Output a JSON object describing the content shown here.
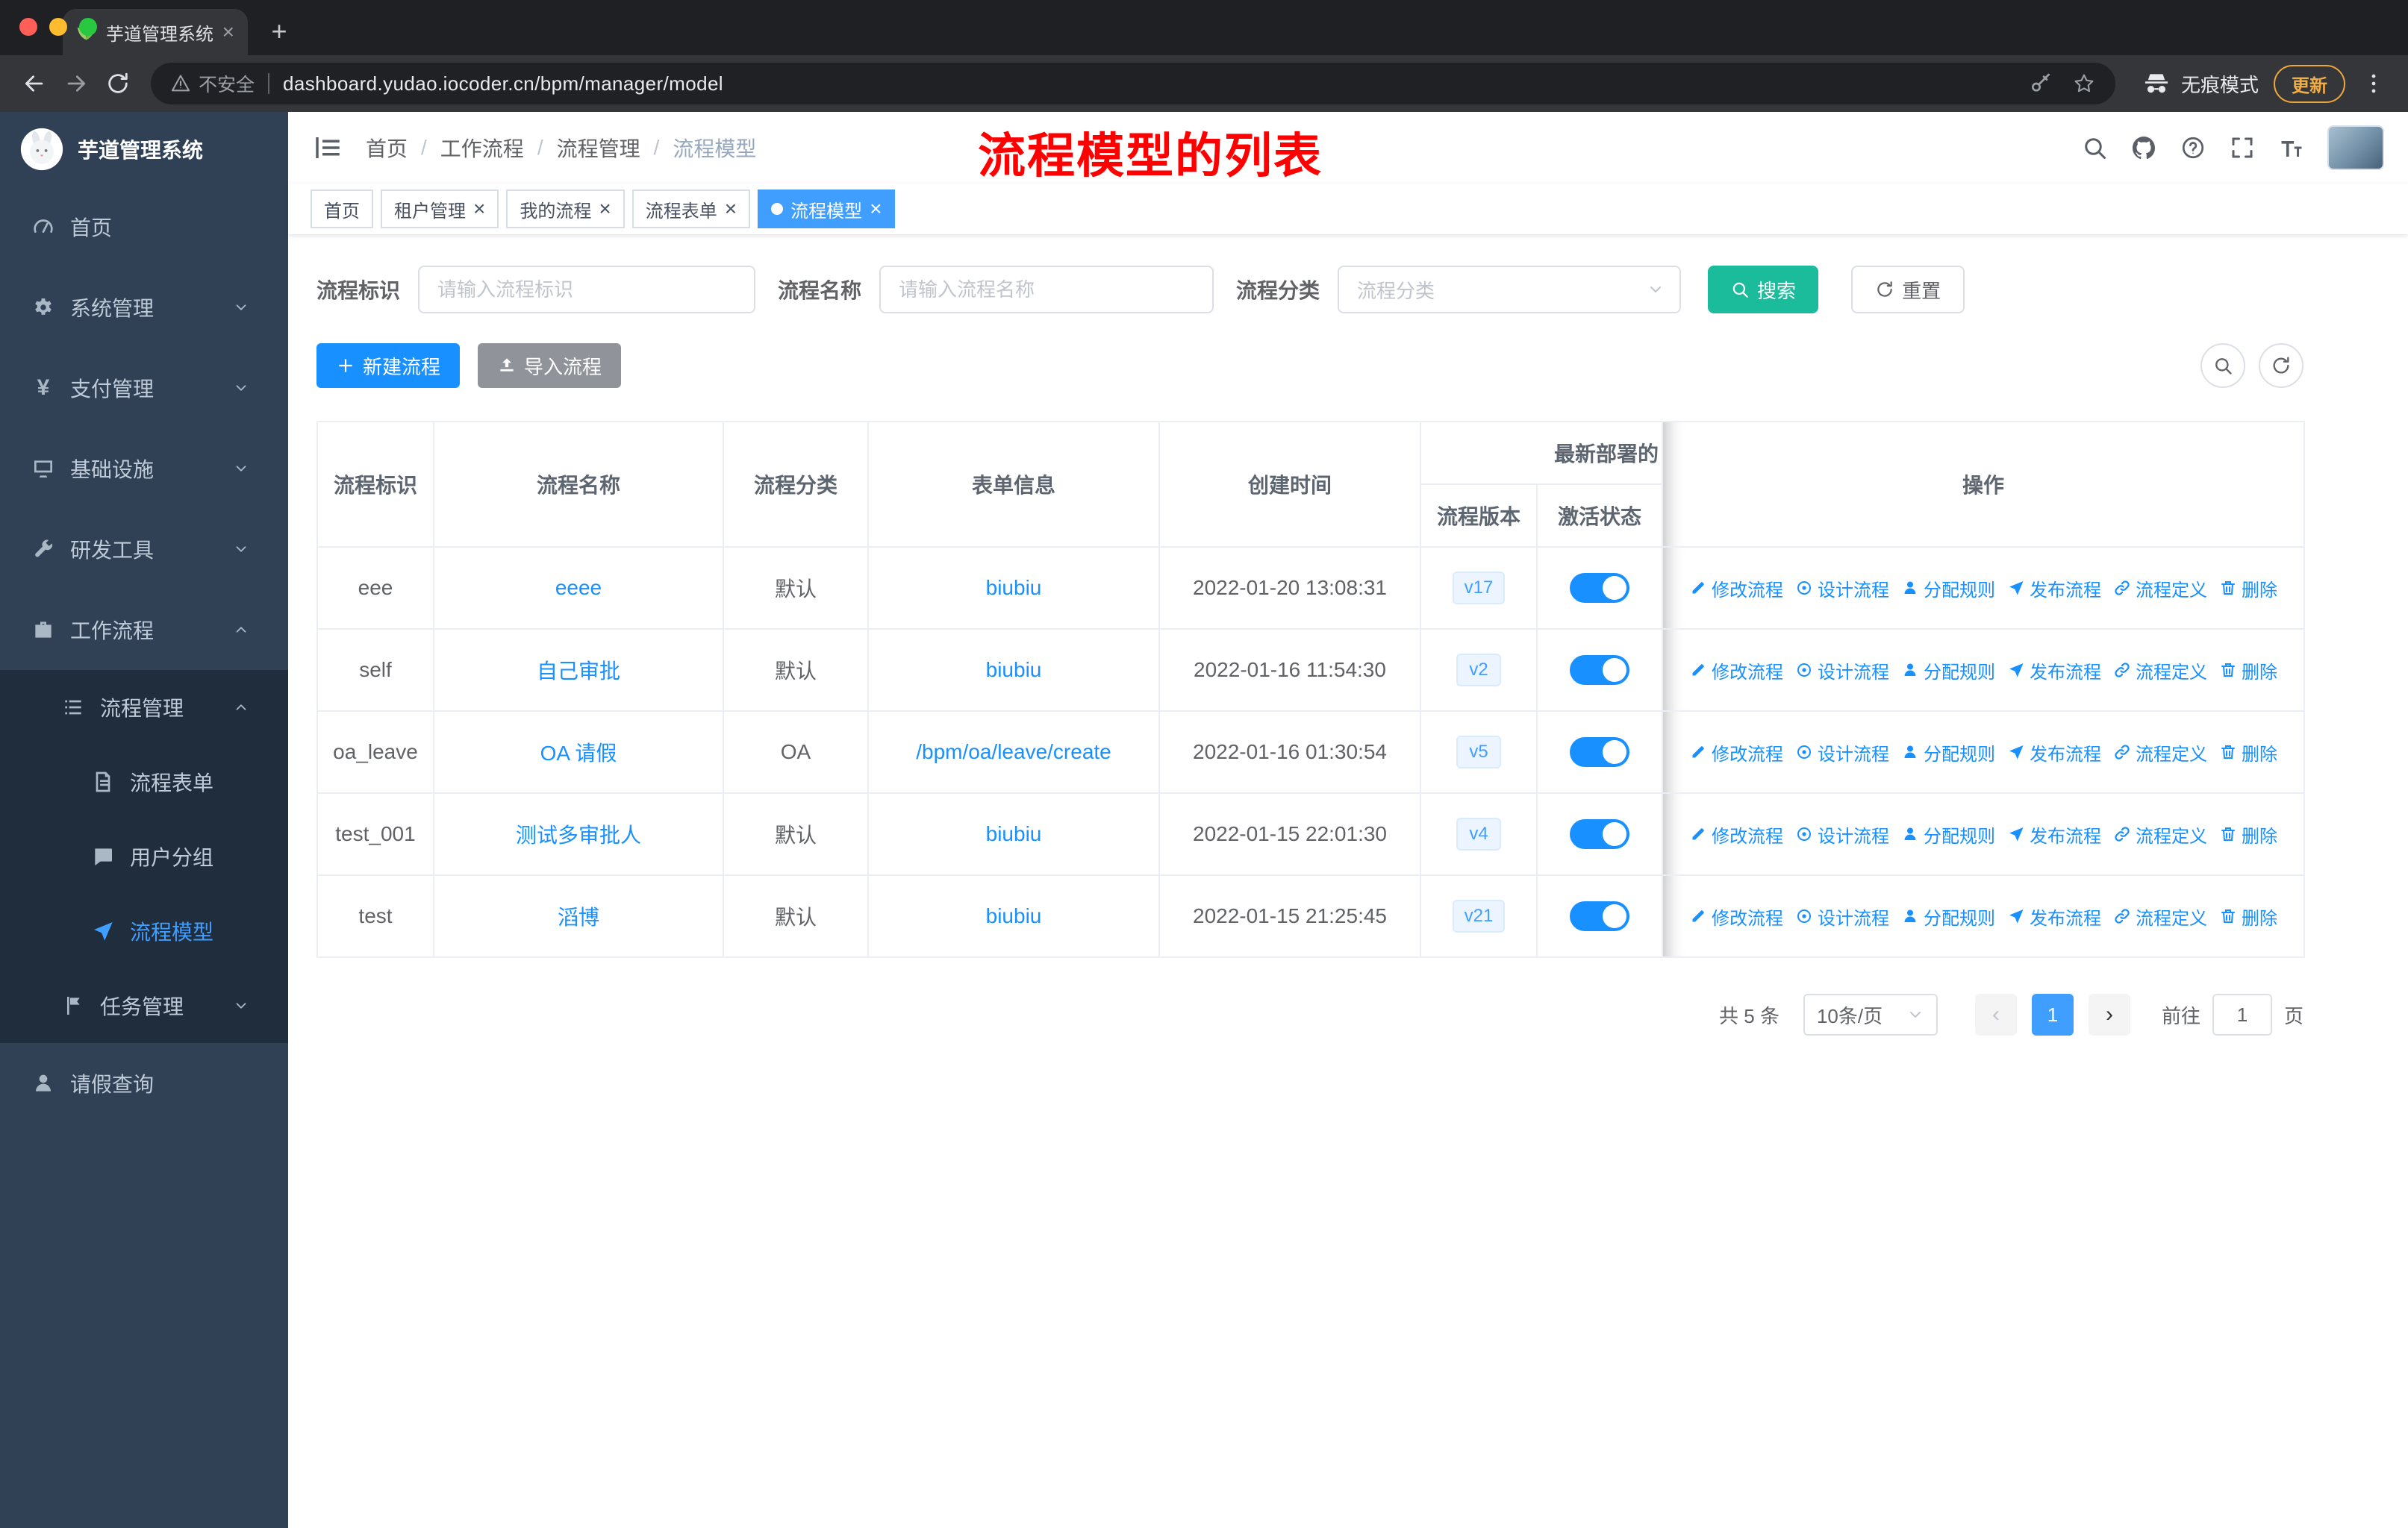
{
  "browser": {
    "tab_title": "芋道管理系统",
    "url": "dashboard.yudao.iocoder.cn/bpm/manager/model",
    "security_label": "不安全",
    "incognito_label": "无痕模式",
    "update_button": "更新"
  },
  "sidebar": {
    "logo_title": "芋道管理系统",
    "items": [
      {
        "key": "home",
        "label": "首页",
        "icon": "dashboard-icon",
        "level": 1
      },
      {
        "key": "system",
        "label": "系统管理",
        "icon": "gear-icon",
        "level": 1,
        "chevron": "down"
      },
      {
        "key": "payment",
        "label": "支付管理",
        "icon": "payment-icon",
        "level": 1,
        "chevron": "down"
      },
      {
        "key": "infrastructure",
        "label": "基础设施",
        "icon": "infrastructure-icon",
        "level": 1,
        "chevron": "down"
      },
      {
        "key": "devtools",
        "label": "研发工具",
        "icon": "tool-icon",
        "level": 1,
        "chevron": "down"
      },
      {
        "key": "workflow",
        "label": "工作流程",
        "icon": "workflow-icon",
        "level": 1,
        "chevron": "up"
      },
      {
        "key": "process-management",
        "label": "流程管理",
        "icon": "process-icon",
        "level": 2,
        "chevron": "up",
        "dark": true
      },
      {
        "key": "process-form",
        "label": "流程表单",
        "icon": "form-icon",
        "level": 3,
        "dark": true
      },
      {
        "key": "user-group",
        "label": "用户分组",
        "icon": "group-icon",
        "level": 3,
        "dark": true
      },
      {
        "key": "process-model",
        "label": "流程模型",
        "icon": "model-icon",
        "level": 3,
        "dark": true,
        "active": true
      },
      {
        "key": "task-management",
        "label": "任务管理",
        "icon": "task-icon",
        "level": 2,
        "chevron": "down",
        "dark": true
      },
      {
        "key": "leave-query",
        "label": "请假查询",
        "icon": "user-icon",
        "level": 1
      }
    ]
  },
  "header": {
    "breadcrumb": [
      "首页",
      "工作流程",
      "流程管理",
      "流程模型"
    ],
    "annotation": "流程模型的列表"
  },
  "tabs": [
    {
      "key": "home",
      "label": "首页",
      "closable": false,
      "active": false
    },
    {
      "key": "tenant",
      "label": "租户管理",
      "closable": true,
      "active": false
    },
    {
      "key": "my-process",
      "label": "我的流程",
      "closable": true,
      "active": false
    },
    {
      "key": "process-form",
      "label": "流程表单",
      "closable": true,
      "active": false
    },
    {
      "key": "process-model",
      "label": "流程模型",
      "closable": true,
      "active": true
    }
  ],
  "filters": {
    "fields": [
      {
        "label": "流程标识",
        "placeholder": "请输入流程标识",
        "type": "input"
      },
      {
        "label": "流程名称",
        "placeholder": "请输入流程名称",
        "type": "input"
      },
      {
        "label": "流程分类",
        "placeholder": "流程分类",
        "type": "select"
      }
    ],
    "search_label": "搜索",
    "reset_label": "重置"
  },
  "toolbar": {
    "create_label": "新建流程",
    "import_label": "导入流程"
  },
  "table": {
    "columns": [
      "流程标识",
      "流程名称",
      "流程分类",
      "表单信息",
      "创建时间"
    ],
    "group_header": "最新部署的",
    "sub_columns": [
      "流程版本",
      "激活状态"
    ],
    "ops_header": "操作",
    "row_ops": [
      {
        "key": "modify-process",
        "label": "修改流程",
        "icon": "edit-icon"
      },
      {
        "key": "design-process",
        "label": "设计流程",
        "icon": "design-icon"
      },
      {
        "key": "assign-rule",
        "label": "分配规则",
        "icon": "assign-icon"
      },
      {
        "key": "publish-process",
        "label": "发布流程",
        "icon": "publish-icon"
      },
      {
        "key": "process-definition",
        "label": "流程定义",
        "icon": "definition-icon"
      },
      {
        "key": "delete",
        "label": "删除",
        "icon": "delete-icon"
      }
    ],
    "rows": [
      {
        "id": "eee",
        "name": "eeee",
        "category": "默认",
        "form": "biubiu",
        "created": "2022-01-20 13:08:31",
        "version": "v17",
        "active": true
      },
      {
        "id": "self",
        "name": "自己审批",
        "category": "默认",
        "form": "biubiu",
        "created": "2022-01-16 11:54:30",
        "version": "v2",
        "active": true
      },
      {
        "id": "oa_leave",
        "name": "OA 请假",
        "category": "OA",
        "form": "/bpm/oa/leave/create",
        "created": "2022-01-16 01:30:54",
        "version": "v5",
        "active": true
      },
      {
        "id": "test_001",
        "name": "测试多审批人",
        "category": "默认",
        "form": "biubiu",
        "created": "2022-01-15 22:01:30",
        "version": "v4",
        "active": true
      },
      {
        "id": "test",
        "name": "滔博",
        "category": "默认",
        "form": "biubiu",
        "created": "2022-01-15 21:25:45",
        "version": "v21",
        "active": true
      }
    ]
  },
  "pagination": {
    "total": "共 5 条",
    "page_size": "10条/页",
    "current_page": "1",
    "goto_label": "前往",
    "goto_value": "1",
    "page_unit": "页"
  },
  "colors": {
    "accent": "#409eff",
    "link": "#1890ff",
    "search_button": "#1abc9c",
    "import_button": "#909399",
    "annotation": "#ff0000",
    "sidebar_bg": "#304156",
    "submenu_bg": "#1f2d3d",
    "toggle_on": "#1890ff"
  }
}
